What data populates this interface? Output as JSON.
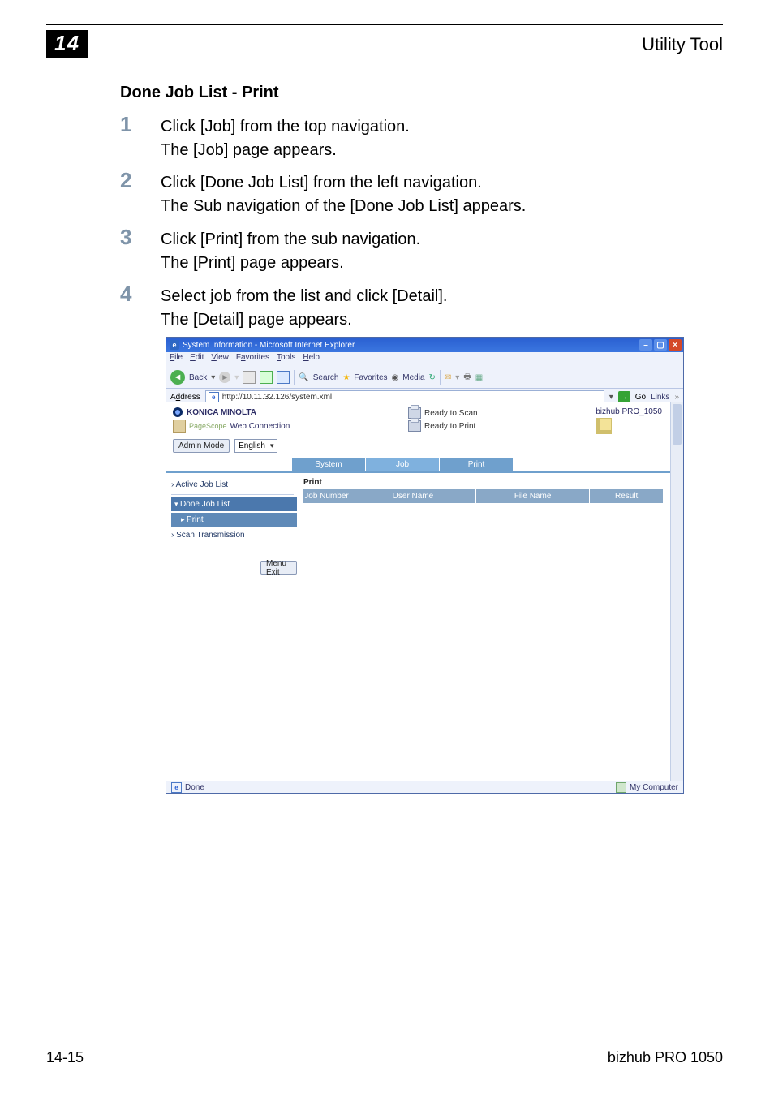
{
  "header": {
    "chapter_number": "14",
    "right_title": "Utility Tool"
  },
  "section_heading": "Done Job List - Print",
  "steps": {
    "s1": {
      "num": "1",
      "line1": "Click [Job] from the top navigation.",
      "line2": "The [Job] page appears."
    },
    "s2": {
      "num": "2",
      "line1": "Click [Done Job List] from the left navigation.",
      "line2": "The Sub navigation of the [Done Job List] appears."
    },
    "s3": {
      "num": "3",
      "line1": "Click [Print] from the sub navigation.",
      "line2": "The [Print] page appears."
    },
    "s4": {
      "num": "4",
      "line1": "Select job from the list and click [Detail].",
      "line2": "The [Detail] page appears."
    }
  },
  "ie": {
    "title": "System Information - Microsoft Internet Explorer",
    "menu": {
      "file": "File",
      "edit": "Edit",
      "view": "View",
      "favorites": "Favorites",
      "tools": "Tools",
      "help": "Help"
    },
    "toolbar": {
      "back": "Back",
      "search": "Search",
      "favorites": "Favorites",
      "media": "Media"
    },
    "address_label": "Address",
    "address_value": "http://10.11.32.126/system.xml",
    "go_label": "Go",
    "links_label": "Links",
    "brand": "KONICA MINOLTA",
    "pagescope_label": "Web Connection",
    "pagescope_prefix": "PageScope",
    "status": {
      "scan": "Ready to Scan",
      "print": "Ready to Print"
    },
    "model": "bizhub PRO_1050",
    "admin_button": "Admin Mode",
    "language_value": "English",
    "tabs": {
      "system": "System",
      "job": "Job",
      "print": "Print"
    },
    "nav": {
      "active": "Active Job List",
      "done": "Done Job List",
      "print_sub": "Print",
      "scan": "Scan Transmission"
    },
    "menu_exit": "Menu Exit",
    "panel_title": "Print",
    "columns": {
      "jobnum": "Job Number",
      "user": "User Name",
      "file": "File Name",
      "result": "Result"
    },
    "status_done": "Done",
    "status_right": "My Computer"
  },
  "footer": {
    "page_number": "14-15",
    "product": "bizhub PRO 1050"
  }
}
